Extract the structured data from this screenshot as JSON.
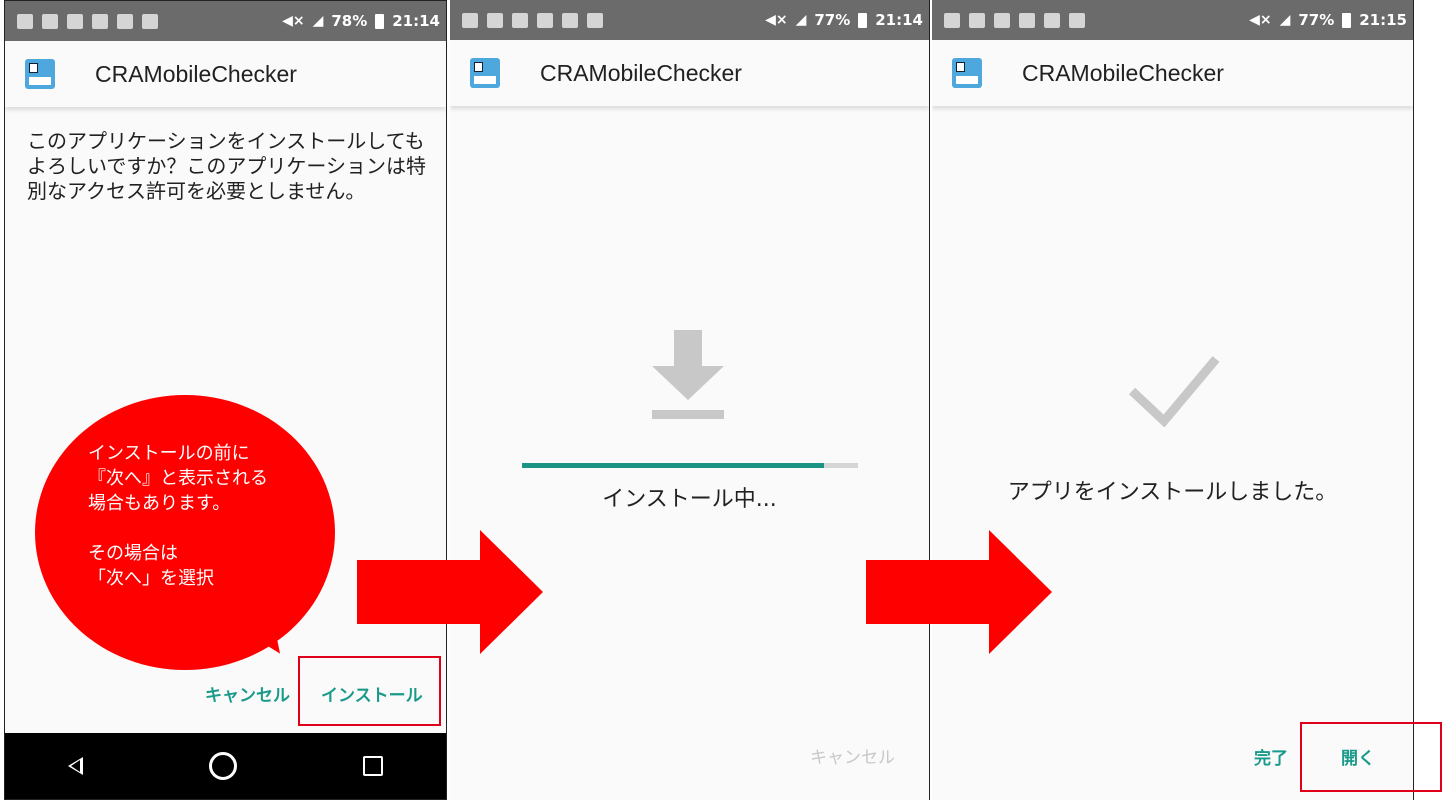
{
  "screens": [
    {
      "status": {
        "volume": "◀×",
        "battery": "78%",
        "time": "21:14"
      },
      "app_title": "CRAMobileChecker",
      "message": "このアプリケーションをインストールしてもよろしいですか？このアプリケーションは特別なアクセス許可を必要としません。",
      "cancel_label": "キャンセル",
      "install_label": "インストール"
    },
    {
      "status": {
        "volume": "◀×",
        "battery": "77%",
        "time": "21:14"
      },
      "app_title": "CRAMobileChecker",
      "status_text": "インストール中...",
      "progress": 0.9,
      "cancel_label": "キャンセル"
    },
    {
      "status": {
        "volume": "◀×",
        "battery": "77%",
        "time": "21:15"
      },
      "app_title": "CRAMobileChecker",
      "status_text": "アプリをインストールしました。",
      "done_label": "完了",
      "open_label": "開く"
    }
  ],
  "callout": {
    "lines": [
      "インストールの前に",
      "『次へ』と表示される",
      "場合もあります。",
      "",
      "その場合は",
      "「次へ」を選択"
    ]
  },
  "colors": {
    "accent": "#1a9a8a",
    "annotation": "#ff0000",
    "progress": "#1b9484"
  },
  "icons": [
    "app-icon",
    "download-icon",
    "check-icon",
    "back-icon",
    "home-icon",
    "recents-icon",
    "right-arrow"
  ]
}
